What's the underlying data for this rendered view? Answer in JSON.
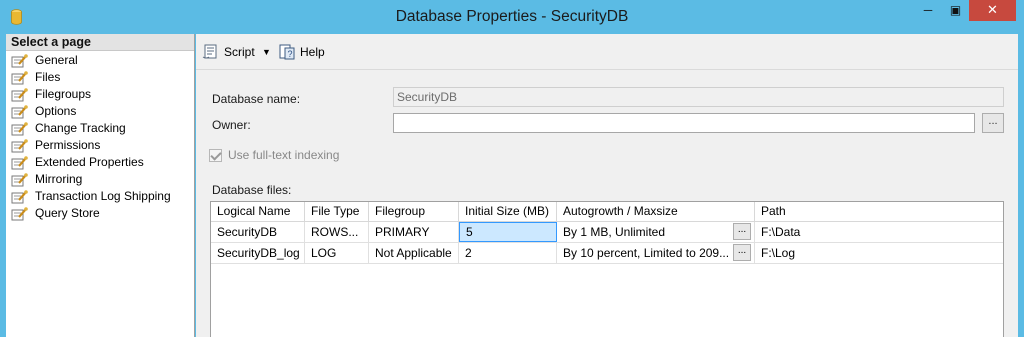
{
  "window": {
    "title": "Database Properties - SecurityDB",
    "controls": {
      "minimize": "─",
      "maximize": "▣",
      "close": "✕"
    }
  },
  "sidebar": {
    "header": "Select a page",
    "items": [
      {
        "label": "General"
      },
      {
        "label": "Files"
      },
      {
        "label": "Filegroups"
      },
      {
        "label": "Options"
      },
      {
        "label": "Change Tracking"
      },
      {
        "label": "Permissions"
      },
      {
        "label": "Extended Properties"
      },
      {
        "label": "Mirroring"
      },
      {
        "label": "Transaction Log Shipping"
      },
      {
        "label": "Query Store"
      }
    ]
  },
  "toolbar": {
    "script_label": "Script",
    "help_label": "Help",
    "script_icon": "script-icon",
    "help_icon": "help-icon"
  },
  "form": {
    "database_name_label": "Database name:",
    "database_name_value": "SecurityDB",
    "owner_label": "Owner:",
    "owner_value": "",
    "owner_browse": "...",
    "fulltext_label": "Use full-text indexing",
    "fulltext_checked": true,
    "files_label": "Database files:"
  },
  "grid": {
    "columns": [
      "Logical Name",
      "File Type",
      "Filegroup",
      "Initial Size (MB)",
      "Autogrowth / Maxsize",
      "Path"
    ],
    "rows": [
      {
        "logical_name": "SecurityDB",
        "file_type": "ROWS...",
        "filegroup": "PRIMARY",
        "initial_size": "5",
        "autogrowth": "By 1 MB, Unlimited",
        "ellipsis": "...",
        "path": "F:\\Data"
      },
      {
        "logical_name": "SecurityDB_log",
        "file_type": "LOG",
        "filegroup": "Not Applicable",
        "initial_size": "2",
        "autogrowth": "By 10 percent, Limited to 209...",
        "ellipsis": "...",
        "path": "F:\\Log"
      }
    ]
  },
  "colors": {
    "titlebar": "#5bbbe4",
    "close_button": "#c7493e",
    "selected_cell": "#cce8ff",
    "selected_border": "#3399ff"
  }
}
